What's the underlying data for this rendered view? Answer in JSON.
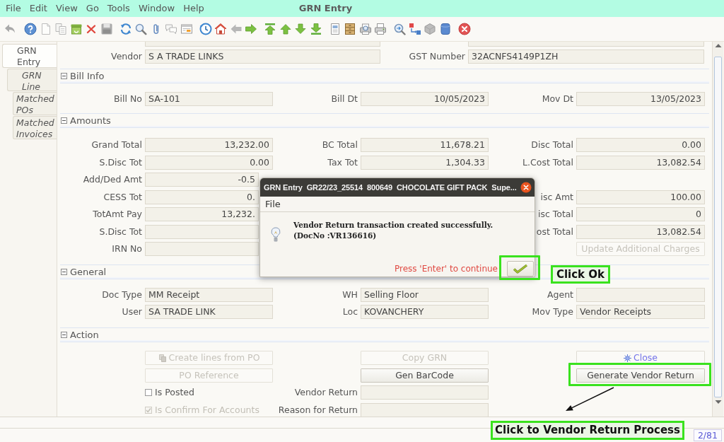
{
  "window": {
    "title": "GRN Entry"
  },
  "menu": [
    {
      "label": "File"
    },
    {
      "label": "Edit"
    },
    {
      "label": "View"
    },
    {
      "label": "Go"
    },
    {
      "label": "Tools"
    },
    {
      "label": "Window"
    },
    {
      "label": "Help"
    }
  ],
  "side_tabs": [
    {
      "label": "GRN Entry",
      "selected": true
    },
    {
      "label": "GRN Line",
      "selected": false
    },
    {
      "label": "Matched POs",
      "selected": false
    },
    {
      "label": "Matched Invoices",
      "selected": false
    }
  ],
  "top_fields": [
    {
      "label": "Vendor",
      "value": "S A TRADE LINKS"
    },
    {
      "label": "GST Number",
      "value": "32ACNFS4149P1ZH"
    }
  ],
  "sections": [
    {
      "title": "Bill Info",
      "expanded": true,
      "rows": [
        {
          "left": {
            "kind": "text",
            "label": "Bill No",
            "value": "SA-101"
          },
          "middle": {
            "kind": "number",
            "label": "Bill Dt",
            "value": "10/05/2023"
          },
          "right": {
            "kind": "number",
            "label": "Mov Dt",
            "value": "13/05/2023"
          }
        }
      ]
    },
    {
      "title": "Amounts",
      "expanded": true,
      "rows": [
        {
          "left": {
            "kind": "number",
            "label": "Grand Total",
            "value": "13,232.00"
          },
          "middle": {
            "kind": "number",
            "label": "BC Total",
            "value": "11,678.21"
          },
          "right": {
            "kind": "number",
            "label": "Disc Total",
            "value": "0.00"
          }
        },
        {
          "left": {
            "kind": "number",
            "label": "S.Disc Tot",
            "value": "0.00"
          },
          "middle": {
            "kind": "number",
            "label": "Tax Tot",
            "value": "1,304.33"
          },
          "right": {
            "kind": "number",
            "label": "L.Cost Total",
            "value": "13,082.54"
          }
        },
        {
          "left": {
            "kind": "number",
            "label": "Add/Ded Amt",
            "value": "-0.5"
          }
        },
        {
          "left": {
            "kind": "number",
            "label": "CESS Tot",
            "value": "0."
          },
          "right": {
            "kind": "number",
            "label": "isc Amt",
            "value": "100.00"
          }
        },
        {
          "left": {
            "kind": "number",
            "label": "TotAmt Pay",
            "value": "13,232."
          },
          "right": {
            "kind": "number",
            "label": "isc Total",
            "value": "0"
          }
        },
        {
          "left": {
            "kind": "number",
            "label": "S.Disc Tot"
          },
          "right": {
            "kind": "number",
            "label": "ost Total",
            "value": "13,082.54"
          }
        },
        {
          "left": {
            "kind": "text",
            "label": "IRN No"
          },
          "right": {
            "kind": "button",
            "label": "Update Additional Charges",
            "disabled": true,
            "highlighted": false
          }
        }
      ]
    },
    {
      "title": "General",
      "expanded": true,
      "rows": [
        {
          "left": {
            "kind": "text",
            "label": "Doc Type",
            "value": "MM Receipt"
          },
          "middle": {
            "kind": "text",
            "label": "WH",
            "value": "Selling Floor"
          },
          "right": {
            "kind": "text",
            "label": "Agent"
          }
        },
        {
          "left": {
            "kind": "text",
            "label": "User",
            "value": "SA TRADE LINK"
          },
          "middle": {
            "kind": "text",
            "label": "Loc",
            "value": "KOVANCHERY"
          },
          "right": {
            "kind": "text",
            "label": "Mov Type",
            "value": "Vendor Receipts"
          }
        }
      ]
    },
    {
      "title": "Action",
      "expanded": true,
      "rows": [
        {
          "left": {
            "kind": "icon-button",
            "label": "Create lines from PO",
            "disabled": true,
            "highlighted": false
          },
          "middle": {
            "kind": "button",
            "label": "Copy GRN",
            "disabled": true,
            "highlighted": false
          },
          "right": {
            "kind": "link-button",
            "label": "Close",
            "disabled": false,
            "highlighted": false
          }
        },
        {
          "left": {
            "kind": "button",
            "label": "PO Reference",
            "disabled": true,
            "highlighted": false
          },
          "middle": {
            "kind": "button",
            "label": "Gen BarCode",
            "disabled": false,
            "highlighted": false
          },
          "right": {
            "kind": "button",
            "label": "Generate Vendor Return",
            "disabled": false,
            "highlighted": true
          }
        },
        {
          "left": {
            "kind": "checkbox",
            "label": "Is Posted",
            "checked": false,
            "disabled": false
          },
          "middle": {
            "kind": "text",
            "label": "Vendor Return"
          }
        },
        {
          "left": {
            "kind": "checkbox",
            "label": "Is Confirm For Accounts",
            "checked": true,
            "disabled": true
          },
          "middle": {
            "kind": "text",
            "label": "Reason for Return"
          }
        }
      ]
    }
  ],
  "dialog": {
    "title": "GRN Entry  GR22/23_25514  800649  CHOCOLATE GIFT PACK  Supe...",
    "menu": [
      {
        "label": "File"
      }
    ],
    "message": [
      "Vendor Return transaction created successfully.",
      "(DocNo :VR136616)"
    ],
    "hint": "Press 'Enter' to continue",
    "ok_button": {
      "highlighted": true
    }
  },
  "callouts": [
    {
      "text": "Click Ok",
      "arrow": false
    },
    {
      "text": "Click to Vendor Return Process",
      "arrow": true
    }
  ],
  "status_bar": {
    "counter": "2/81"
  }
}
